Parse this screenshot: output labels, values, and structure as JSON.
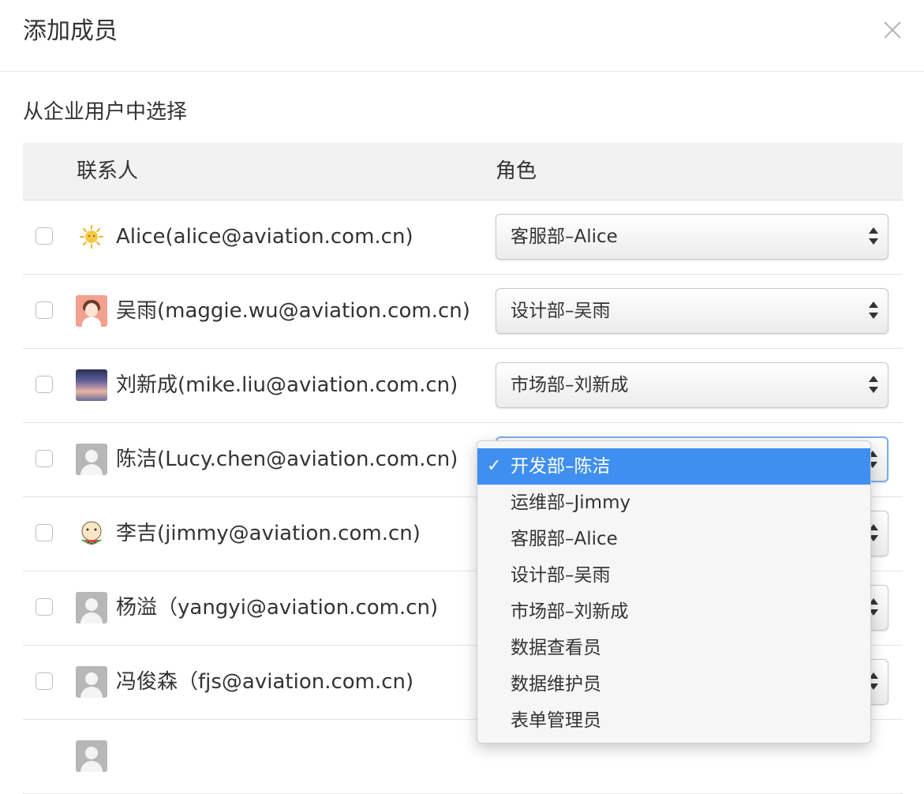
{
  "dialog": {
    "title": "添加成员",
    "close_label": "×"
  },
  "section_label": "从企业用户中选择",
  "table": {
    "headers": {
      "contact": "联系人",
      "role": "角色"
    },
    "rows": [
      {
        "contact": "Alice(alice@aviation.com.cn)",
        "role": "客服部–Alice",
        "avatar": "sun-avatar"
      },
      {
        "contact": "吴雨(maggie.wu@aviation.com.cn)",
        "role": "设计部–吴雨",
        "avatar": "girl-avatar"
      },
      {
        "contact": "刘新成(mike.liu@aviation.com.cn)",
        "role": "市场部–刘新成",
        "avatar": "sunset-avatar"
      },
      {
        "contact": "陈洁(Lucy.chen@aviation.com.cn)",
        "role": "开发部–陈洁",
        "avatar": "default-user-avatar"
      },
      {
        "contact": "李吉(jimmy@aviation.com.cn)",
        "role": "",
        "avatar": "watermelon-meme-avatar"
      },
      {
        "contact": "杨溢（yangyi@aviation.com.cn)",
        "role": "",
        "avatar": "default-user-avatar"
      },
      {
        "contact": "冯俊森（fjs@aviation.com.cn)",
        "role": "",
        "avatar": "default-user-avatar"
      }
    ]
  },
  "dropdown": {
    "selected_index": 0,
    "check_mark": "✓",
    "options": [
      "开发部–陈洁",
      "运维部–Jimmy",
      "客服部–Alice",
      "设计部–吴雨",
      "市场部–刘新成",
      "数据查看员",
      "数据维护员",
      "表单管理员"
    ]
  },
  "colors": {
    "selected_option": "#3f8ff0",
    "focus_border": "#79aee8",
    "header_bg": "#f2f2f2"
  }
}
